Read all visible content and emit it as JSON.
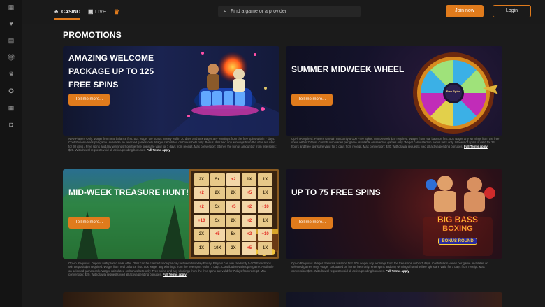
{
  "nav": {
    "tabs": [
      {
        "label": "CASINO",
        "icon": "spade-icon",
        "active": true
      },
      {
        "label": "LIVE",
        "icon": "live-card-icon",
        "active": false
      }
    ],
    "trophy_icon": "trophy-icon"
  },
  "sidebar": {
    "icons": [
      "grid-icon",
      "heart-icon",
      "table-icon",
      "gift-icon",
      "trophy-icon",
      "chip-icon",
      "apps-icon",
      "chat-icon"
    ]
  },
  "search": {
    "placeholder": "Find a game or a provider"
  },
  "auth": {
    "join_label": "Join now",
    "login_label": "Login"
  },
  "colors": {
    "accent": "#e07b1c",
    "background": "#1b1b1b"
  },
  "page": {
    "title": "PROMOTIONS"
  },
  "promotions": [
    {
      "title": "AMAZING WELCOME PACKAGE UP TO 125 FREE SPINS",
      "button": "Tell me more...",
      "terms": "New Players Only. Wager from real balance first. 50x wager the bonus money within 30 days and 50x wager any winnings from the free spins within 7 days. Contribution varies per game. Available on selected games only. Wager calculated on bonus bets only. Bonus offer and any winnings from the offer are valid for 30 days / Free spins and any winnings from the free spins are valid for 7 days from receipt. Max conversion: 3 times the bonus amount or from free spins: $20. Withdrawal requests void all active/pending bonuses.",
      "terms_link": "Full Terms apply"
    },
    {
      "title": "SUMMER MIDWEEK WHEEL",
      "button": "Tell me more...",
      "terms": "Opt-in Required. Players can win randomly 5-100 Free Spins. Min Deposit $20 required. Wager from real balance first. 50x wager any winnings from the free spins within 7 days. Contribution varies per game. Available on selected games only. Wager calculated on bonus bets only. Wheels of spins is valid for 24 hours and free spins are valid for 7 days from receipt. Max conversion: $20. Withdrawal requests void all active/pending bonuses.",
      "terms_link": "Full Terms apply",
      "wheel_label": "Free Spins"
    },
    {
      "title": "MID-WEEK TREASURE HUNT!",
      "button": "Tell me more...",
      "terms": "Opt-in Required. Deposit with promo code offer. Offer can be claimed once per day between Monday-Friday. Players can win randomly 5-100 Free Spins. Min Deposit $20 required. Wager from real balance first. 50x wager any winnings from the free spins within 7 days. Contribution varies per game. Available on selected games only. Wager calculated on bonus bets only. Free spins and any winnings from the free spins are valid for 7 days from receipt. Max conversion: $20. Withdrawal requests void all active/pending bonuses.",
      "terms_link": "Full Terms apply",
      "board": [
        "2X",
        "5x",
        "+2",
        "1X",
        "1X",
        "+2",
        "2X",
        "2X",
        "+5",
        "1X",
        "+2",
        "5x",
        "+5",
        "+2",
        "+10",
        "+10",
        "5x",
        "2X",
        "+2",
        "1X",
        "2X",
        "+5",
        "5x",
        "+2",
        "+10",
        "1X",
        "10X",
        "2X",
        "+5",
        "1X"
      ]
    },
    {
      "title": "UP TO 75 FREE SPINS",
      "button": "Tell me more...",
      "terms": "Opt-in Required. Wager from real balance first. 50x wager any winnings from the free spins within 7 days. Contribution varies per game. Available on selected games only. Wager calculated on bonus bets only. Free spins and any winnings from the free spins are valid for 7 days from receipt. Max conversion: $20. Withdrawal requests void all active/pending bonuses.",
      "terms_link": "Full Terms apply",
      "logo_lines": [
        "BIG BASS",
        "BOXING",
        "BONUS ROUND"
      ]
    }
  ]
}
